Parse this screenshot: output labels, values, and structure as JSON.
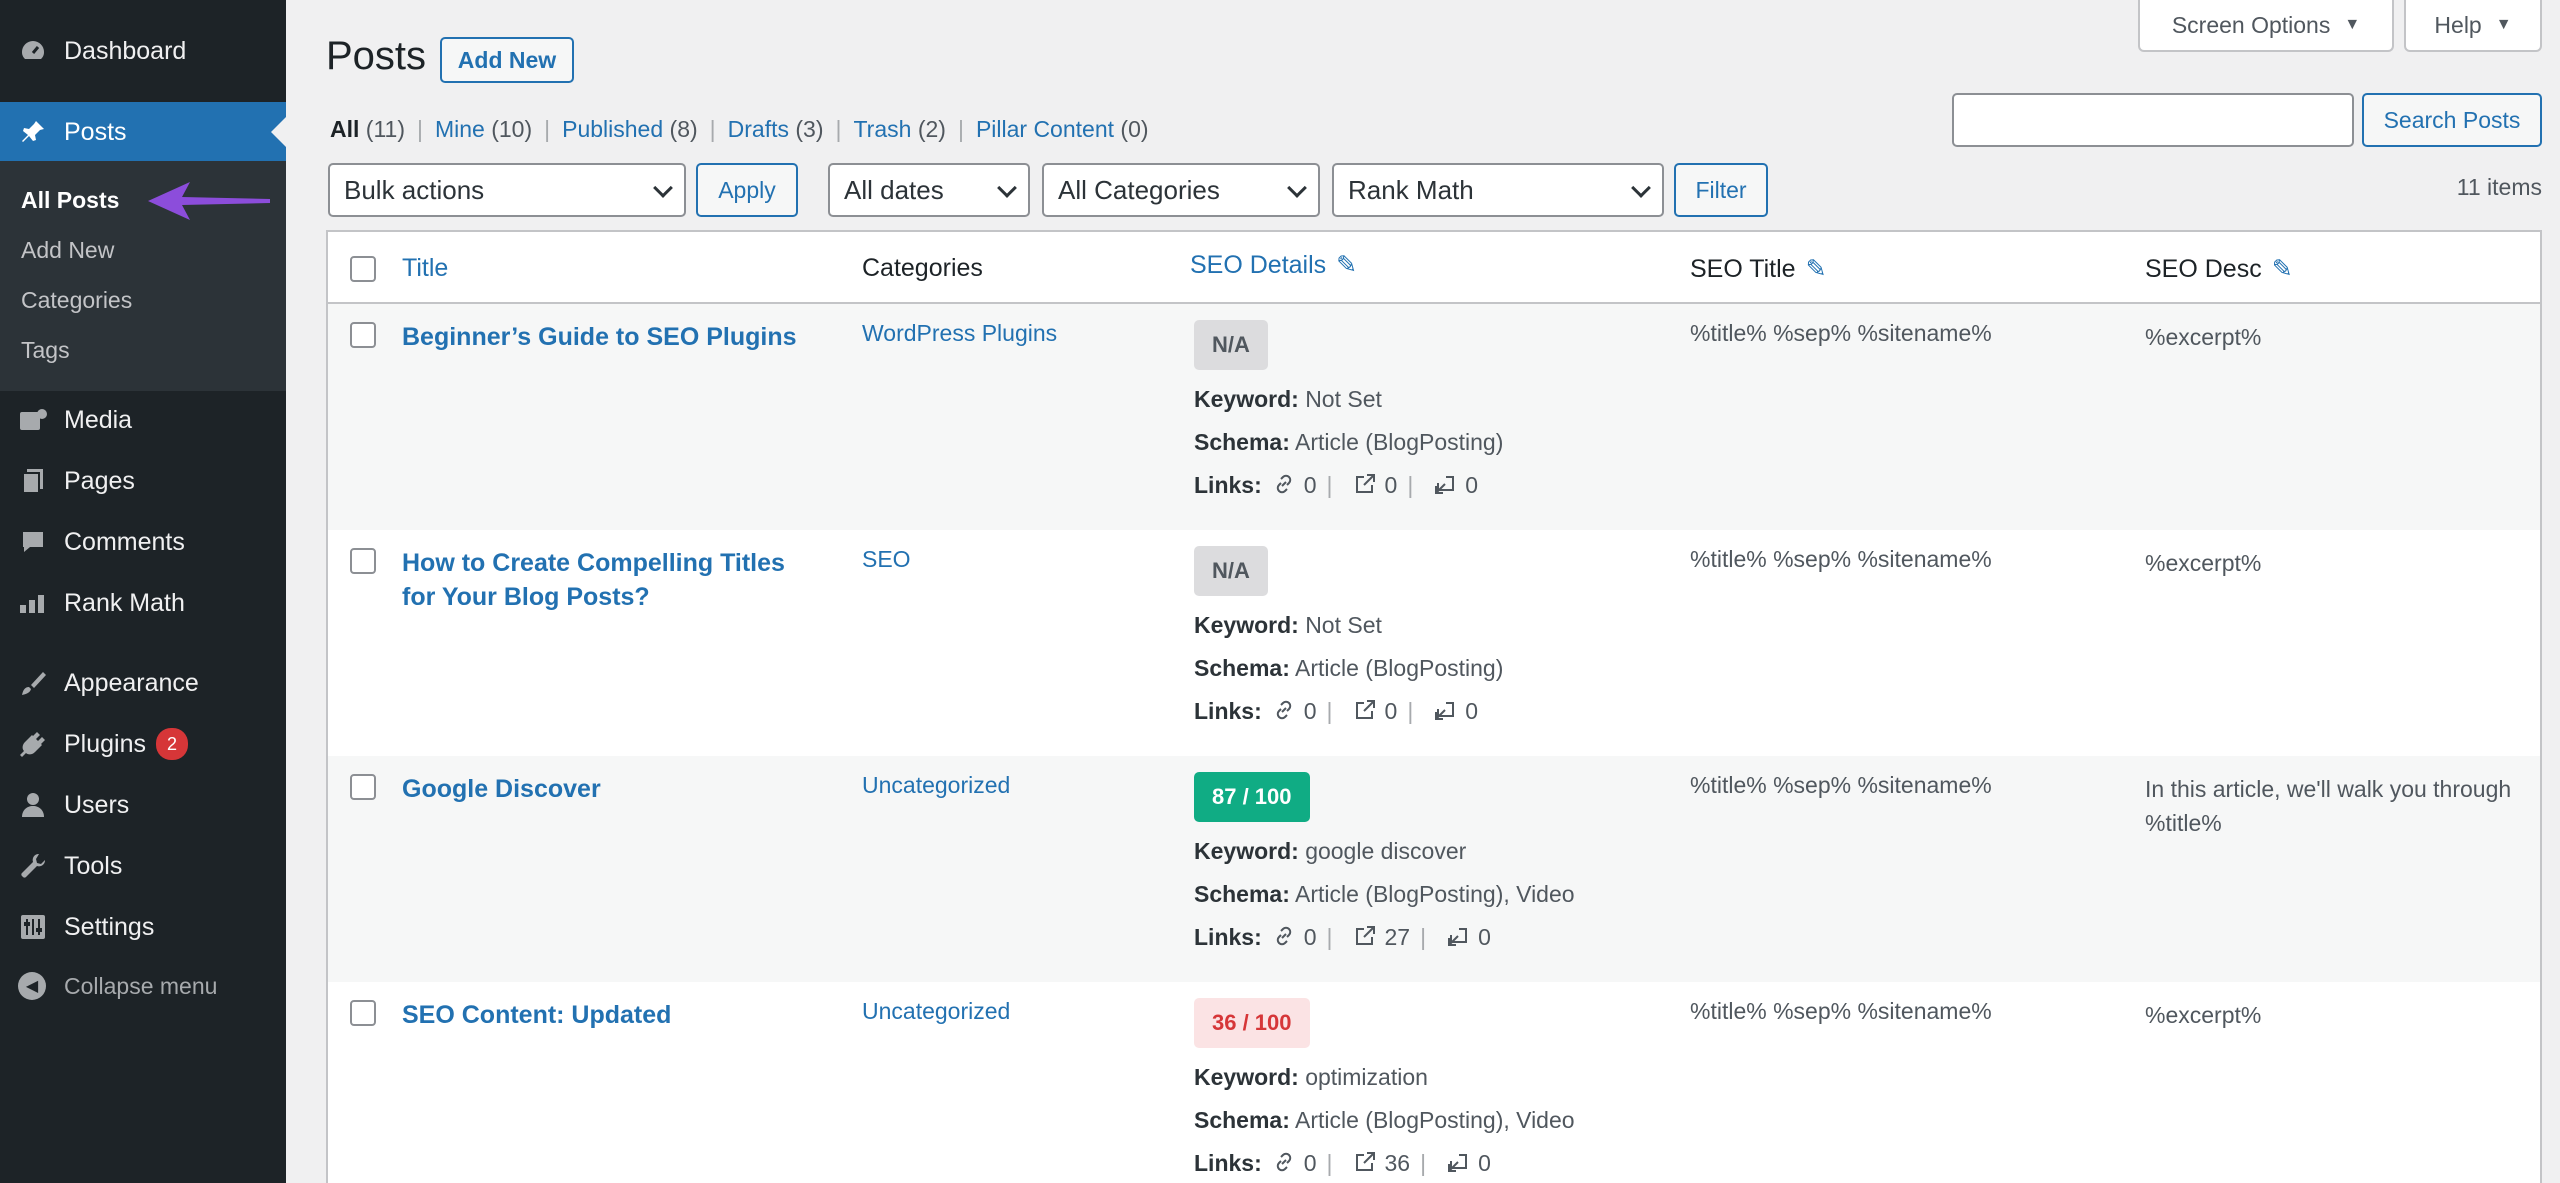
{
  "sidebar": {
    "items": [
      {
        "label": "Dashboard",
        "icon": "dashboard-icon"
      },
      {
        "label": "Posts",
        "icon": "pin-icon"
      },
      {
        "label": "Media",
        "icon": "media-icon"
      },
      {
        "label": "Pages",
        "icon": "pages-icon"
      },
      {
        "label": "Comments",
        "icon": "comments-icon"
      },
      {
        "label": "Rank Math",
        "icon": "rank-math-icon"
      },
      {
        "label": "Appearance",
        "icon": "brush-icon"
      },
      {
        "label": "Plugins",
        "icon": "plugin-icon",
        "badge": "2"
      },
      {
        "label": "Users",
        "icon": "user-icon"
      },
      {
        "label": "Tools",
        "icon": "wrench-icon"
      },
      {
        "label": "Settings",
        "icon": "settings-icon"
      }
    ],
    "submenu": [
      "All Posts",
      "Add New",
      "Categories",
      "Tags"
    ],
    "collapse": "Collapse menu"
  },
  "header": {
    "title": "Posts",
    "add_new": "Add New",
    "screen_options": "Screen Options",
    "help": "Help"
  },
  "views": [
    {
      "label": "All",
      "count": "(11)"
    },
    {
      "label": "Mine",
      "count": "(10)"
    },
    {
      "label": "Published",
      "count": "(8)"
    },
    {
      "label": "Drafts",
      "count": "(3)"
    },
    {
      "label": "Trash",
      "count": "(2)"
    },
    {
      "label": "Pillar Content",
      "count": "(0)"
    }
  ],
  "filters": {
    "bulk_actions": "Bulk actions",
    "apply": "Apply",
    "dates": "All dates",
    "categories": "All Categories",
    "rank_math": "Rank Math",
    "filter": "Filter",
    "search_button": "Search Posts",
    "search_value": "",
    "items_count": "11 items"
  },
  "columns": {
    "title": "Title",
    "categories": "Categories",
    "seo_details": "SEO Details",
    "seo_title": "SEO Title",
    "seo_desc": "SEO Desc"
  },
  "labels": {
    "keyword": "Keyword:",
    "schema": "Schema:",
    "links": "Links:"
  },
  "rows": [
    {
      "title": "Beginner’s Guide to SEO Plugins",
      "category": "WordPress Plugins",
      "score": "N/A",
      "keyword": "Not Set",
      "schema": "Article (BlogPosting)",
      "links_internal": "0",
      "links_external": "0",
      "links_incoming": "0",
      "seo_title": "%title% %sep% %sitename%",
      "seo_desc": "%excerpt%"
    },
    {
      "title": "How to Create Compelling Titles for Your Blog Posts?",
      "category": "SEO",
      "score": "N/A",
      "keyword": "Not Set",
      "schema": "Article (BlogPosting)",
      "links_internal": "0",
      "links_external": "0",
      "links_incoming": "0",
      "seo_title": "%title% %sep% %sitename%",
      "seo_desc": "%excerpt%"
    },
    {
      "title": "Google Discover",
      "category": "Uncategorized",
      "score": "87 / 100",
      "keyword": "google discover",
      "schema": "Article (BlogPosting), Video",
      "links_internal": "0",
      "links_external": "27",
      "links_incoming": "0",
      "seo_title": "%title% %sep% %sitename%",
      "seo_desc": "In this article, we'll walk you through %title%"
    },
    {
      "title": "SEO Content: Updated",
      "category": "Uncategorized",
      "score": "36 / 100",
      "keyword": "optimization",
      "schema": "Article (BlogPosting), Video",
      "links_internal": "0",
      "links_external": "36",
      "links_incoming": "0",
      "seo_title": "%title% %sep% %sitename%",
      "seo_desc": "%excerpt%"
    }
  ],
  "colors": {
    "accent": "#2271b1",
    "sidebar": "#1d2327",
    "good": "#10ac84",
    "bad": "#d63638",
    "arrow": "#8c4ddb"
  }
}
